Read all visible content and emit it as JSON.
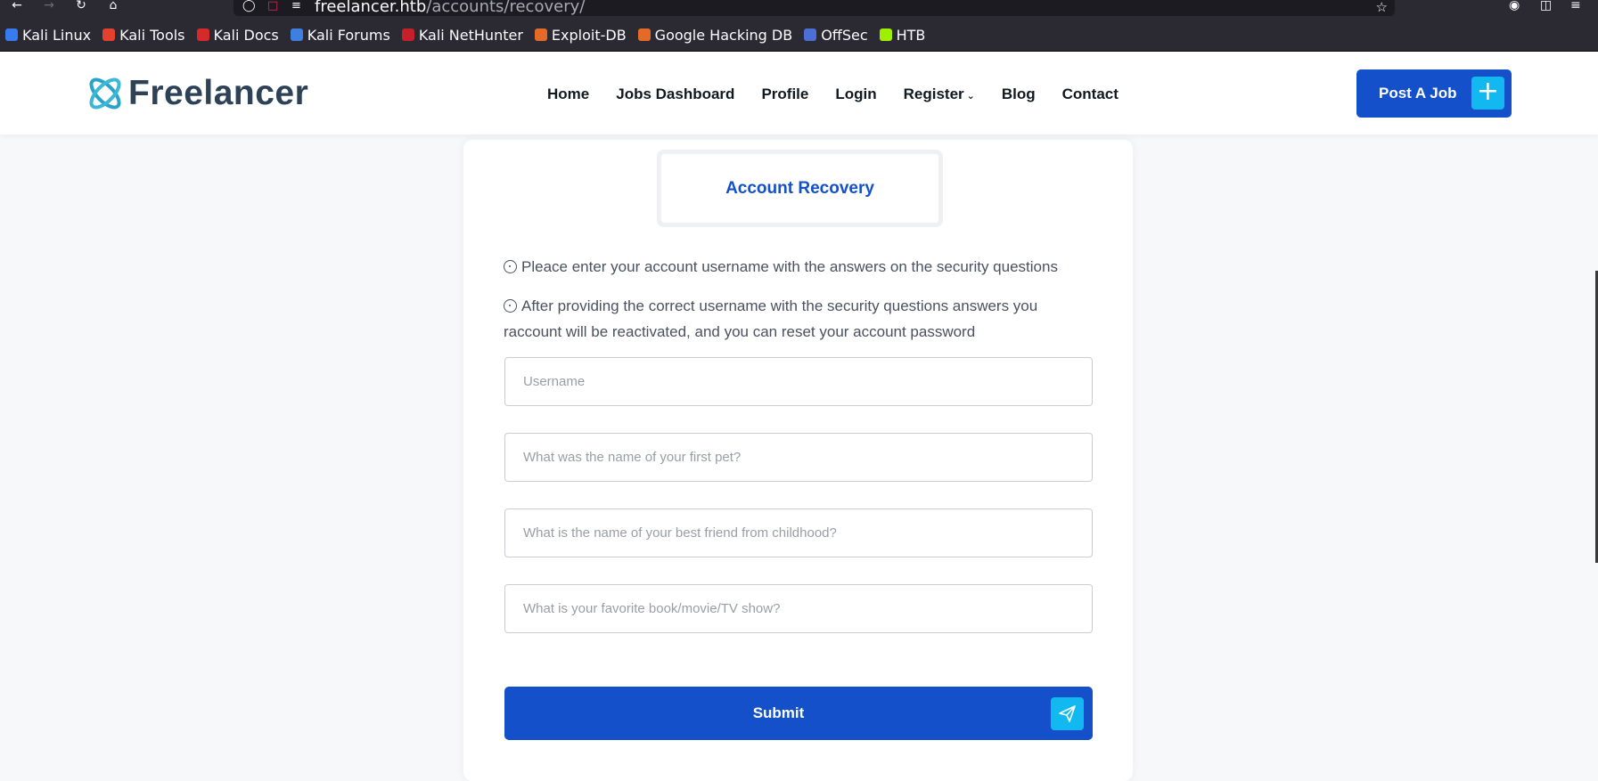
{
  "browser": {
    "url_host": "freelancer.htb",
    "url_path": "/accounts/recovery/",
    "bookmarks": [
      {
        "label": "Kali Linux",
        "color": "#367bf0"
      },
      {
        "label": "Kali Tools",
        "color": "#e2412f"
      },
      {
        "label": "Kali Docs",
        "color": "#d42a2a"
      },
      {
        "label": "Kali Forums",
        "color": "#3f7fe0"
      },
      {
        "label": "Kali NetHunter",
        "color": "#c7202b"
      },
      {
        "label": "Exploit-DB",
        "color": "#e56a28"
      },
      {
        "label": "Google Hacking DB",
        "color": "#e56a28"
      },
      {
        "label": "OffSec",
        "color": "#4c6fd6"
      },
      {
        "label": "HTB",
        "color": "#9fef00"
      }
    ]
  },
  "site": {
    "logo_text": "Freelancer",
    "nav": {
      "home": "Home",
      "jobs": "Jobs Dashboard",
      "profile": "Profile",
      "login": "Login",
      "register": "Register",
      "blog": "Blog",
      "contact": "Contact"
    },
    "post_job_label": "Post A Job"
  },
  "recovery": {
    "tab_label": "Account Recovery",
    "info_1": "Pleace enter your account username with the answers on the security questions",
    "info_2": "After providing the correct username with the security questions answers you raccount will be reactivated, and you can reset your account password",
    "username_placeholder": "Username",
    "q1_placeholder": "What was the name of your first pet?",
    "q2_placeholder": "What is the name of your best friend from childhood?",
    "q3_placeholder": "What is your favorite book/movie/TV show?",
    "submit_label": "Submit"
  },
  "colors": {
    "primary": "#1350c9",
    "accent": "#12b8f0"
  }
}
